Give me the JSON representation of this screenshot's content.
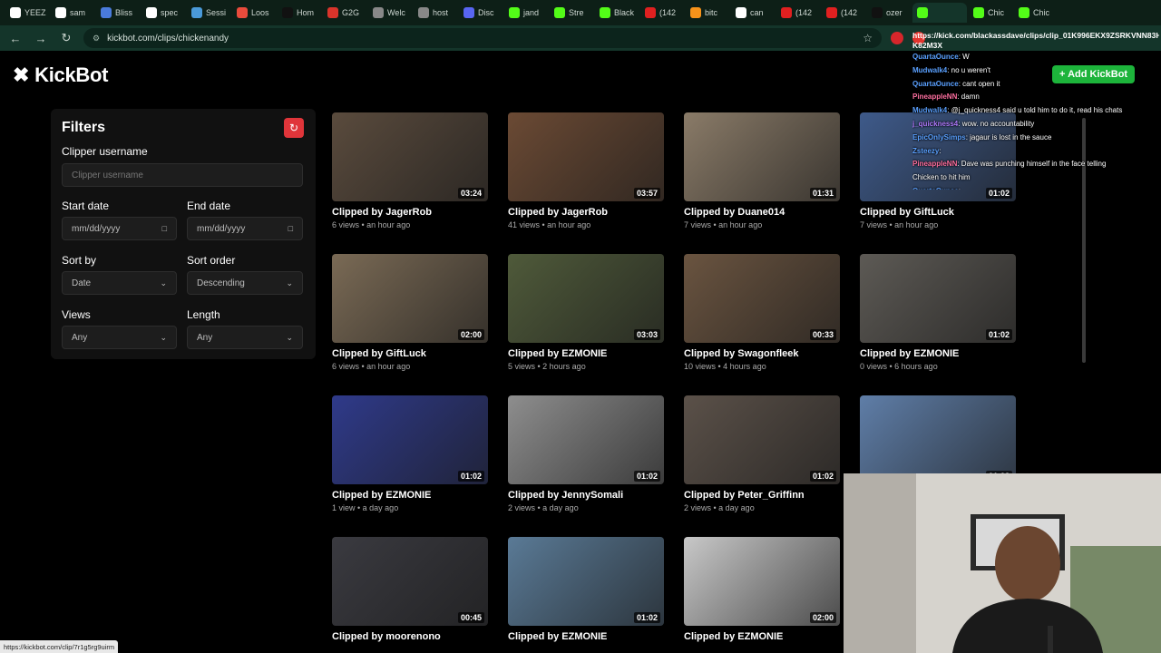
{
  "browser": {
    "tabs": [
      {
        "label": "YEEZ",
        "color": "#ffffff"
      },
      {
        "label": "sam",
        "color": "#ffffff"
      },
      {
        "label": "Bliss",
        "color": "#4a7bdc"
      },
      {
        "label": "spec",
        "color": "#ffffff"
      },
      {
        "label": "Sessi",
        "color": "#4a9ad9"
      },
      {
        "label": "Loos",
        "color": "#e94b3c"
      },
      {
        "label": "Hom",
        "color": "#111111"
      },
      {
        "label": "G2G",
        "color": "#d9342b"
      },
      {
        "label": "Welc",
        "color": "#888888"
      },
      {
        "label": "host",
        "color": "#888888"
      },
      {
        "label": "Disc",
        "color": "#5865f2"
      },
      {
        "label": "jand",
        "color": "#53fc18"
      },
      {
        "label": "Stre",
        "color": "#53fc18"
      },
      {
        "label": "Black",
        "color": "#53fc18"
      },
      {
        "label": "(142",
        "color": "#e02020"
      },
      {
        "label": "bitc",
        "color": "#f7931a"
      },
      {
        "label": "can",
        "color": "#ffffff"
      },
      {
        "label": "(142",
        "color": "#e02020"
      },
      {
        "label": "(142",
        "color": "#e02020"
      },
      {
        "label": "ozer",
        "color": "#111111"
      },
      {
        "label": "",
        "color": "#53fc18"
      },
      {
        "label": "Chic",
        "color": "#53fc18"
      },
      {
        "label": "Chic",
        "color": "#53fc18"
      }
    ],
    "url": "kickbot.com/clips/chickenandy",
    "status_link": "https://kickbot.com/clip/7r1g5rg9uirm"
  },
  "app": {
    "logo_text": "KickBot",
    "add_button": "+ Add KickBot"
  },
  "filters": {
    "title": "Filters",
    "clipper_label": "Clipper username",
    "clipper_placeholder": "Clipper username",
    "start_label": "Start date",
    "start_placeholder": "mm/dd/yyyy",
    "end_label": "End date",
    "end_placeholder": "mm/dd/yyyy",
    "sort_by_label": "Sort by",
    "sort_by_value": "Date",
    "sort_order_label": "Sort order",
    "sort_order_value": "Descending",
    "views_label": "Views",
    "views_value": "Any",
    "length_label": "Length",
    "length_value": "Any"
  },
  "clips": [
    {
      "duration": "03:24",
      "title": "Clipped by JagerRob",
      "meta": "6 views • an hour ago",
      "bg": "#5a4b3d"
    },
    {
      "duration": "03:57",
      "title": "Clipped by JagerRob",
      "meta": "41 views • an hour ago",
      "bg": "#6b4a34"
    },
    {
      "duration": "01:31",
      "title": "Clipped by Duane014",
      "meta": "7 views • an hour ago",
      "bg": "#8a7b68"
    },
    {
      "duration": "01:02",
      "title": "Clipped by GiftLuck",
      "meta": "7 views • an hour ago",
      "bg": "#3e5a8a"
    },
    {
      "duration": "02:00",
      "title": "Clipped by GiftLuck",
      "meta": "6 views • an hour ago",
      "bg": "#7a6a55"
    },
    {
      "duration": "03:03",
      "title": "Clipped by EZMONIE",
      "meta": "5 views • 2 hours ago",
      "bg": "#4f5a3a"
    },
    {
      "duration": "00:33",
      "title": "Clipped by Swagonfleek",
      "meta": "10 views • 4 hours ago",
      "bg": "#6a5440"
    },
    {
      "duration": "01:02",
      "title": "Clipped by EZMONIE",
      "meta": "0 views • 6 hours ago",
      "bg": "#5d5a55"
    },
    {
      "duration": "01:02",
      "title": "Clipped by EZMONIE",
      "meta": "1 view • a day ago",
      "bg": "#2f3a8a"
    },
    {
      "duration": "01:02",
      "title": "Clipped by JennySomali",
      "meta": "2 views • a day ago",
      "bg": "#8e8e8e"
    },
    {
      "duration": "01:02",
      "title": "Clipped by Peter_Griffinn",
      "meta": "2 views • a day ago",
      "bg": "#5b5149"
    },
    {
      "duration": "01:02",
      "title": "",
      "meta": "",
      "bg": "#5f7ea8"
    },
    {
      "duration": "00:45",
      "title": "Clipped by moorenono",
      "meta": "",
      "bg": "#3a3a40"
    },
    {
      "duration": "01:02",
      "title": "Clipped by EZMONIE",
      "meta": "",
      "bg": "#5a7a96"
    },
    {
      "duration": "02:00",
      "title": "Clipped by EZMONIE",
      "meta": "",
      "bg": "#c8c8c8"
    }
  ],
  "chat": {
    "url_line1": "https://kick.com/blackassdave/clips/clip_01K996EKX9ZSRKVNN83H",
    "url_line2": "K82M3X",
    "messages": [
      {
        "user": "QuartaOunce",
        "text": ": W",
        "color": "#5aa0ff"
      },
      {
        "user": "Mudwalk4",
        "text": ": no u weren't",
        "color": "#5aa0ff"
      },
      {
        "user": "QuartaOunce",
        "text": ": cant open it",
        "color": "#5aa0ff"
      },
      {
        "user": "PineappleNN",
        "text": ": damn",
        "color": "#ff6fa0"
      },
      {
        "user": "Mudwalk4",
        "text": ": @j_quickness4 said u told him to do it, read his chats",
        "color": "#5aa0ff"
      },
      {
        "user": "j_quickness4",
        "text": ": wow. no accountability",
        "color": "#b07cff"
      },
      {
        "user": "EpicOnlySimps",
        "text": ": jagaur is lost in the sauce",
        "color": "#5aa0ff"
      },
      {
        "user": "Zsteezy",
        "text": ":",
        "color": "#5aa0ff"
      },
      {
        "user": "PineappleNN",
        "text": ": Dave was punching himself in the face telling",
        "color": "#ff6fa0"
      },
      {
        "user": "",
        "text": "Chicken to hit him",
        "color": "#ffffff"
      },
      {
        "user": "QuartaOunce",
        "text": ":",
        "color": "#5aa0ff"
      },
      {
        "user": "QuartaOunce",
        "text": ":",
        "color": "#5aa0ff"
      }
    ]
  }
}
